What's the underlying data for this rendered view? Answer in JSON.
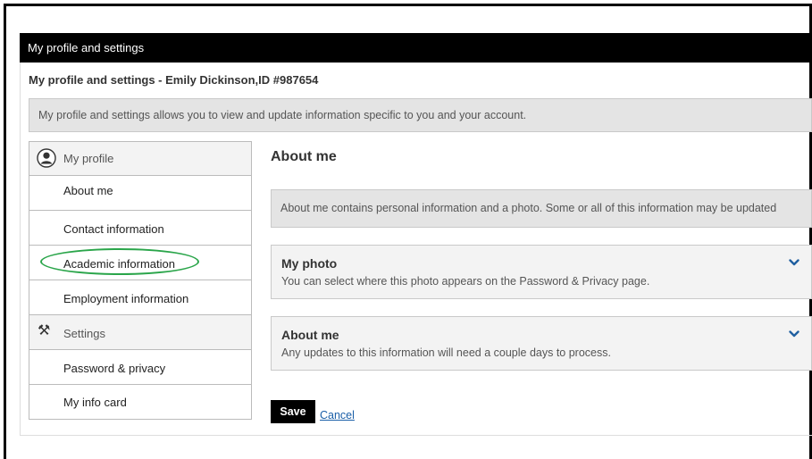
{
  "window": {
    "title": "My profile and settings"
  },
  "page": {
    "subtitle": "My profile and settings - Emily Dickinson,ID #987654",
    "info": "My profile and settings allows you to view and update information specific to you and your account."
  },
  "sidebar": {
    "profile_header": {
      "label": "My profile",
      "icon": "person-circle-icon"
    },
    "profile_items": [
      {
        "label": "About me"
      },
      {
        "label": "Contact information"
      },
      {
        "label": "Academic information",
        "highlight_color": "#2aa54a"
      },
      {
        "label": "Employment information"
      }
    ],
    "settings_header": {
      "label": "Settings",
      "icon": "tools-icon"
    },
    "settings_items": [
      {
        "label": "Password & privacy"
      },
      {
        "label": "My info card"
      }
    ]
  },
  "main": {
    "title": "About me",
    "notice": "About me contains personal information and a photo. Some or all of this information may be updated",
    "sections": [
      {
        "title": "My photo",
        "description": "You can select where this photo appears on the Password & Privacy page."
      },
      {
        "title": "About me",
        "description": "Any updates to this information will need a couple days to process."
      }
    ]
  },
  "actions": {
    "save_label": "Save",
    "cancel_label": "Cancel"
  },
  "colors": {
    "header_bg": "#000000",
    "accent_link": "#1a5fa8",
    "chevron": "#1f5fa0",
    "highlight": "#2aa54a"
  }
}
